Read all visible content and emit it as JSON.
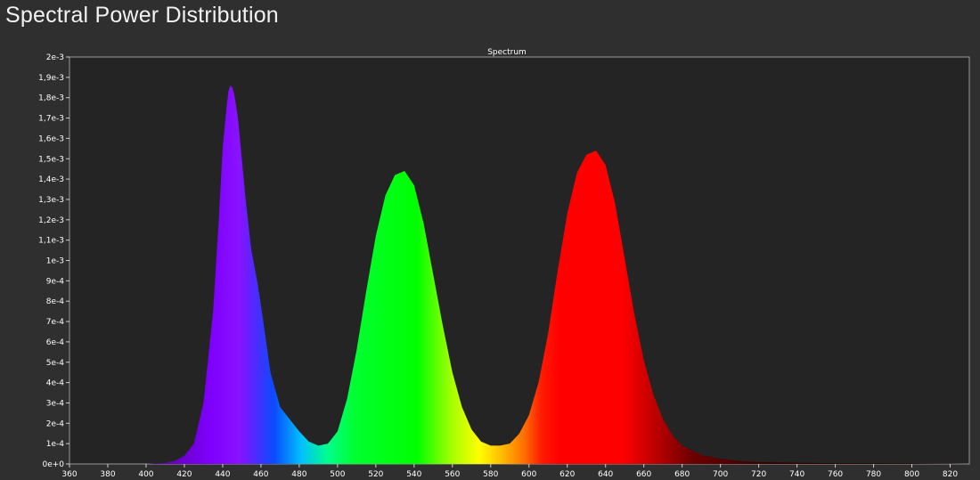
{
  "header": {
    "title": "Spectral Power Distribution"
  },
  "chart_data": {
    "type": "area",
    "title": "Spectrum",
    "xlabel": "",
    "ylabel": "",
    "xlim": [
      360,
      830
    ],
    "ylim": [
      0,
      0.002
    ],
    "x_ticks": [
      360,
      380,
      400,
      420,
      440,
      460,
      480,
      500,
      520,
      540,
      560,
      580,
      600,
      620,
      640,
      660,
      680,
      700,
      720,
      740,
      760,
      780,
      800,
      820
    ],
    "y_ticks": [
      {
        "value": 0,
        "label": "0e+0"
      },
      {
        "value": 0.0001,
        "label": "1e-4"
      },
      {
        "value": 0.0002,
        "label": "2e-4"
      },
      {
        "value": 0.0003,
        "label": "3e-4"
      },
      {
        "value": 0.0004,
        "label": "4e-4"
      },
      {
        "value": 0.0005,
        "label": "5e-4"
      },
      {
        "value": 0.0006,
        "label": "6e-4"
      },
      {
        "value": 0.0007,
        "label": "7e-4"
      },
      {
        "value": 0.0008,
        "label": "8e-4"
      },
      {
        "value": 0.0009,
        "label": "9e-4"
      },
      {
        "value": 0.001,
        "label": "1e-3"
      },
      {
        "value": 0.0011,
        "label": "1,1e-3"
      },
      {
        "value": 0.0012,
        "label": "1,2e-3"
      },
      {
        "value": 0.0013,
        "label": "1,3e-3"
      },
      {
        "value": 0.0014,
        "label": "1,4e-3"
      },
      {
        "value": 0.0015,
        "label": "1,5e-3"
      },
      {
        "value": 0.0016,
        "label": "1,6e-3"
      },
      {
        "value": 0.0017,
        "label": "1,7e-3"
      },
      {
        "value": 0.0018,
        "label": "1,8e-3"
      },
      {
        "value": 0.0019,
        "label": "1,9e-3"
      },
      {
        "value": 0.002,
        "label": "2e-3"
      }
    ],
    "grid": false,
    "fill": "wavelength-colored spectrum",
    "series": [
      {
        "x": [
          360,
          380,
          400,
          410,
          415,
          420,
          425,
          430,
          435,
          438,
          440,
          442,
          443,
          444,
          445,
          446,
          448,
          450,
          452,
          455,
          458,
          460,
          465,
          470,
          475,
          480,
          485,
          490,
          495,
          500,
          505,
          510,
          515,
          520,
          525,
          530,
          535,
          540,
          545,
          550,
          555,
          560,
          565,
          570,
          575,
          580,
          585,
          590,
          595,
          600,
          605,
          610,
          615,
          620,
          625,
          630,
          635,
          640,
          645,
          650,
          655,
          660,
          665,
          670,
          675,
          680,
          690,
          700,
          710,
          720,
          740,
          760,
          780,
          800,
          820,
          830
        ],
        "y": [
          0,
          0,
          0,
          5e-06,
          1.5e-05,
          4e-05,
          0.0001,
          0.0003,
          0.00075,
          0.0012,
          0.00155,
          0.00175,
          0.00183,
          0.00186,
          0.00185,
          0.00182,
          0.0017,
          0.0015,
          0.0013,
          0.00105,
          0.0009,
          0.00078,
          0.00045,
          0.00028,
          0.00022,
          0.00016,
          0.00011,
          9e-05,
          0.0001,
          0.00016,
          0.00032,
          0.00056,
          0.00085,
          0.00112,
          0.00132,
          0.00142,
          0.00144,
          0.00137,
          0.00118,
          0.00093,
          0.00068,
          0.00045,
          0.00028,
          0.00017,
          0.00011,
          9e-05,
          9e-05,
          0.0001,
          0.00015,
          0.00024,
          0.0004,
          0.00064,
          0.00095,
          0.00123,
          0.00143,
          0.00152,
          0.00154,
          0.00147,
          0.00128,
          0.00101,
          0.00074,
          0.00051,
          0.00034,
          0.00022,
          0.00014,
          9e-05,
          4.5e-05,
          2.5e-05,
          1.5e-05,
          1e-05,
          6e-06,
          4e-06,
          3e-06,
          2e-06,
          1e-06,
          0
        ]
      }
    ]
  }
}
